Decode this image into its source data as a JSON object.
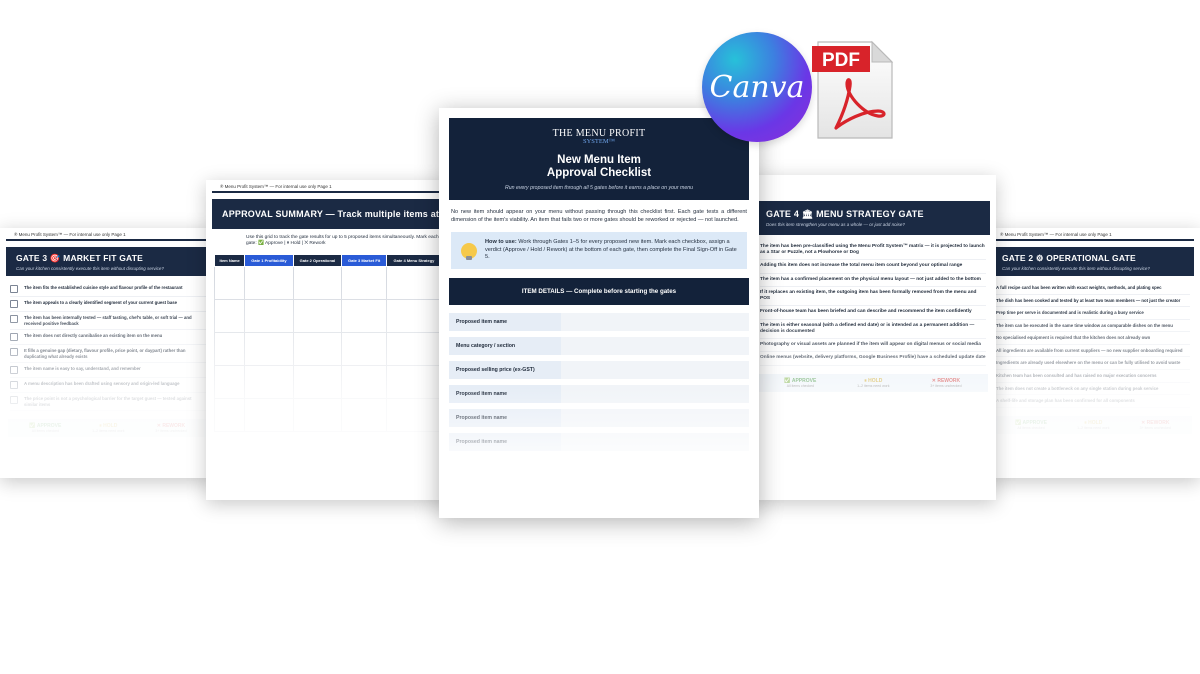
{
  "logos": {
    "canva": "Canva",
    "pdf": "PDF"
  },
  "colors": {
    "navy": "#13223a",
    "approve": "#3a8f3a",
    "hold": "#c9a21d",
    "rework": "#cc2d2d",
    "pdf_red": "#d8232a"
  },
  "page_far_left": {
    "header": "® Menu Profit System™ — For internal use only Page 1",
    "gate_title": "GATE 3 🎯 MARKET FIT GATE",
    "gate_subtitle": "Can your kitchen consistently execute this item without disrupting service?",
    "items": [
      "The item fits the established cuisine style and flavour profile of the restaurant",
      "The item appeals to a clearly identified segment of your current guest base",
      "The item has been internally tested — staff tasting, chef's table, or soft trial — and received positive feedback",
      "The item does not directly cannibalise an existing item on the menu",
      "It fills a genuine gap (dietary, flavour profile, price point, or daypart) rather than duplicating what already exists",
      "The item name is easy to say, understand, and remember",
      "A menu description has been drafted using sensory and origin-led language",
      "The price point is not a psychological barrier for the target guest — tested against similar items"
    ],
    "verdict": {
      "approve": "✅ APPROVE",
      "approve_sub": "All items checked",
      "hold": "⏸ HOLD",
      "hold_sub": "1–2 items need work",
      "rework": "✕ REWORK",
      "rework_sub": "3+ items unchecked"
    }
  },
  "page_left": {
    "header": "® Menu Profit System™ — For internal use only Page 1",
    "title": "APPROVAL SUMMARY — Track multiple items at o",
    "instructions": "Use this grid to track the gate results for up to 5 proposed items simultaneously. Mark each gate: ✅ Approve | ⏸ Hold | ✕ Rework",
    "columns": [
      "Item Name",
      "Gate 1 Profitability",
      "Gate 2 Operational",
      "Gate 3 Market Fit",
      "Gate 4 Menu Strategy"
    ]
  },
  "page_center": {
    "brand_line1": "THE MENU PROFIT",
    "brand_line2": "SYSTEM™",
    "title_line1": "New Menu Item",
    "title_line2": "Approval Checklist",
    "subtitle": "Run every proposed item through all 5 gates before it earns a place on your menu",
    "intro": "No new item should appear on your menu without passing through this checklist first. Each gate tests a different dimension of the item's viability. An item that fails two or more gates should be reworked or rejected — not launched.",
    "howto_label": "How to use:",
    "howto_text": " Work through Gates 1–5 for every proposed new item. Mark each checkbox, assign a verdict (Approve / Hold / Rework) at the bottom of each gate, then complete the Final Sign-Off in Gate 5.",
    "details_header": "ITEM DETAILS — Complete before starting the gates",
    "fields": [
      "Proposed item name",
      "Menu category / section",
      "Proposed selling price (ex-GST)",
      "Proposed item name",
      "Proposed item name",
      "Proposed item name"
    ]
  },
  "page_right": {
    "gate_title": "GATE 4 🏛 MENU STRATEGY GATE",
    "gate_subtitle": "Does this item strengthen your menu as a whole — or just add noise?",
    "items": [
      "The item has been pre-classified using the Menu Profit System™ matrix — it is projected to launch as a Star or Puzzle, not a Plowhorse or Dog",
      "Adding this item does not increase the total menu item count beyond your optimal range",
      "The item has a confirmed placement on the physical menu layout — not just added to the bottom",
      "If it replaces an existing item, the outgoing item has been formally removed from the menu and POS",
      "Front-of-house team has been briefed and can describe and recommend the item confidently",
      "The item is either seasonal (with a defined end date) or is intended as a permanent addition — decision is documented",
      "Photography or visual assets are planned if the item will appear on digital menus or social media",
      "Online menus (website, delivery platforms, Google Business Profile) have a scheduled update date"
    ],
    "verdict": {
      "approve": "✅ APPROVE",
      "approve_sub": "All items checked",
      "hold": "⏸ HOLD",
      "hold_sub": "1–2 items need work",
      "rework": "✕ REWORK",
      "rework_sub": "3+ items unchecked"
    }
  },
  "page_far_right": {
    "header": "® Menu Profit System™ — For internal use only Page 1",
    "gate_title": "GATE 2 ⚙ OPERATIONAL GATE",
    "gate_subtitle": "Can your kitchen consistently execute this item without disrupting service?",
    "items": [
      "A full recipe card has been written with exact weights, methods, and plating spec",
      "The dish has been cooked and tested by at least two team members — not just the creator",
      "Prep time per serve is documented and is realistic during a busy service",
      "The item can be executed in the same time window as comparable dishes on the menu",
      "No specialised equipment is required that the kitchen does not already own",
      "All ingredients are available from current suppliers — no new supplier onboarding required",
      "Ingredients are already used elsewhere on the menu or can be fully utilised to avoid waste",
      "Kitchen team has been consulted and has raised no major execution concerns",
      "The item does not create a bottleneck on any single station during peak service",
      "A shelf-life and storage plan has been confirmed for all components"
    ],
    "verdict": {
      "approve": "✅ APPROVE",
      "approve_sub": "All items checked",
      "hold": "⏸ HOLD",
      "hold_sub": "1–2 items need work",
      "rework": "✕ REWORK",
      "rework_sub": "3+ items unchecked"
    }
  }
}
